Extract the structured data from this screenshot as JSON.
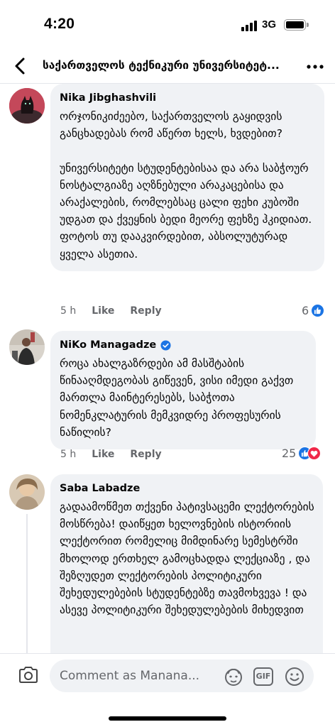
{
  "status": {
    "time": "4:20",
    "network": "3G"
  },
  "nav": {
    "title": "საქართველოს ტექნიკური უნივერსიტეტ..."
  },
  "comments": [
    {
      "author": "Nika Jibghashvili",
      "verified": false,
      "text": "ორჯონიკიძეებო, საქართველოს გაყიდვის განცხადებას რომ აწერთ ხელს, ხვდებით?\n\nუნივერსიტეტი სტუდენტებისაა და არა საბჭოურ ნოსტალგიაზე აღზნებული არაკაცებისა და არაქალების, რომლებსაც ცალი ფეხი კუბოში უდგათ და ქვეყნის ბედი მეორე ფეხზე ჰკიდიათ. ფოტოს თუ დააკვირდებით, აბსოლუტურად ყველა ასეთია.",
      "time": "5 h",
      "like_label": "Like",
      "reply_label": "Reply",
      "reaction_count": "6"
    },
    {
      "author": "NiKo Managadze",
      "verified": true,
      "text": "როცა ახალგაზრდები ამ მასშტაბის წინააღმდეგობას გიწევენ, ვისი იმედი გაქვთ მართლა მაინტერესებს, საბჭოთა ნომენკლატურის მემკვიდრე პროფესურის ნაწილის?",
      "time": "5 h",
      "like_label": "Like",
      "reply_label": "Reply",
      "reaction_count": "25"
    },
    {
      "author": "Saba Labadze",
      "verified": false,
      "text": "გადაამოწმეთ თქვენი პატივსაცემი ლექტორების მოსწრება! დაიწყეთ ხელოვნების ისტორიის ლექტორით რომელიც მიმდინარე სემესტრში მხოლოდ ერთხელ გამოცხადდა ლექციაზე , და შეზღუდეთ ლექტორების პოლიტიკური შეხედულებების სტუდენტებზე თავმოხვევა ! და ასევე პოლიტიკური შეხედულებების მიხედვით"
    }
  ],
  "compose": {
    "placeholder": "Comment as Manana..."
  },
  "colors": {
    "accent": "#1b74e4",
    "love": "#f02849",
    "bubble": "#f0f2f5",
    "meta": "#65676b"
  }
}
